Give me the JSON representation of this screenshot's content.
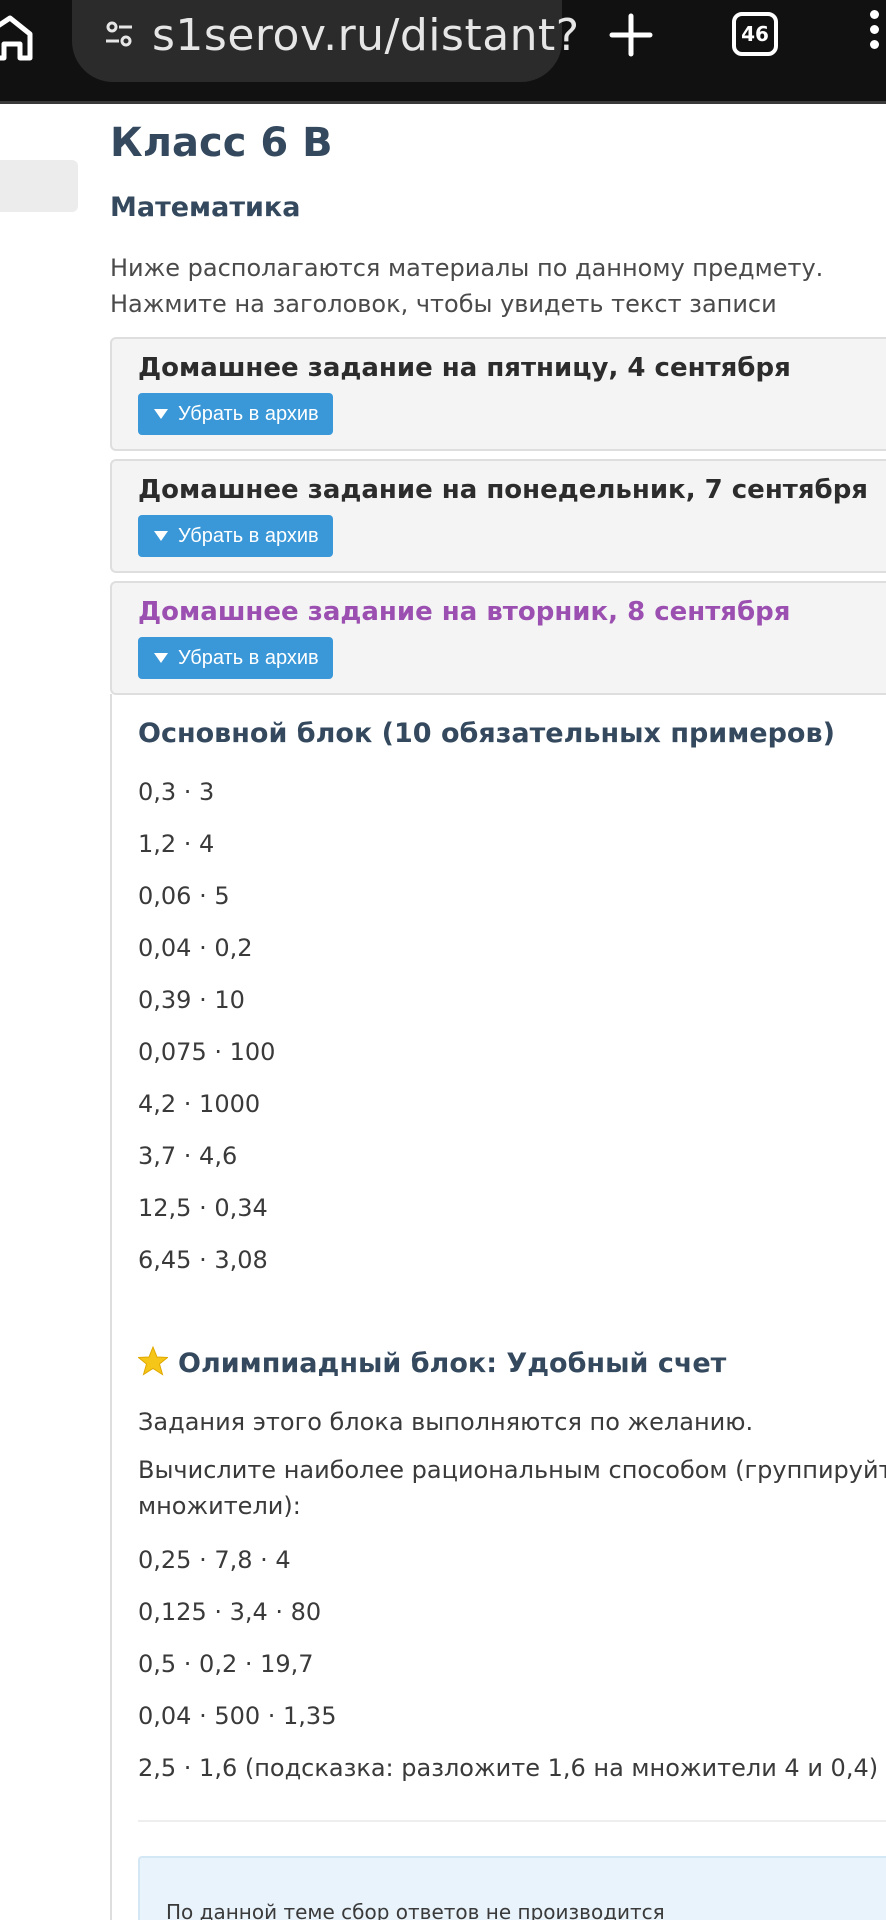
{
  "browser": {
    "url": "s1serov.ru/distant?",
    "tab_count": "46"
  },
  "page": {
    "title": "Класс 6 В",
    "subject": "Математика",
    "intro": "Ниже располагаются материалы по данному предмету. Нажмите на заголовок, чтобы увидеть текст записи"
  },
  "entries": [
    {
      "title": "Домашнее задание на пятницу, 4 сентября",
      "button": "Убрать в архив"
    },
    {
      "title": "Домашнее задание на понедельник, 7 сентября",
      "button": "Убрать в архив"
    },
    {
      "title": "Домашнее задание на вторник, 8 сентября",
      "button": "Убрать в архив"
    }
  ],
  "main_block": {
    "title": "Основной блок (10 обязательных примеров)",
    "items": [
      "0,3 · 3",
      "1,2 · 4",
      "0,06 · 5",
      "0,04 · 0,2",
      "0,39 · 10",
      "0,075 · 100",
      "4,2 · 1000",
      "3,7 · 4,6",
      "12,5 · 0,34",
      "6,45 · 3,08"
    ]
  },
  "olympiad_block": {
    "title": "Олимпиадный блок: Удобный счет",
    "optional_note": "Задания этого блока выполняются по желанию.",
    "instruction": "Вычислите наиболее рациональным способом (группируйте множители):",
    "items": [
      "0,25 · 7,8 · 4",
      "0,125 · 3,4 · 80",
      "0,5 · 0,2 · 19,7",
      "0,04 · 500 · 1,35",
      "2,5 · 1,6 (подсказка: разложите 1,6 на множители 4 и 0,4)"
    ]
  },
  "notice": "По данной теме сбор ответов не производится",
  "colors": {
    "accent_button": "#3a98d8",
    "active_title": "#9b4fb0",
    "star": "#f5c518"
  }
}
